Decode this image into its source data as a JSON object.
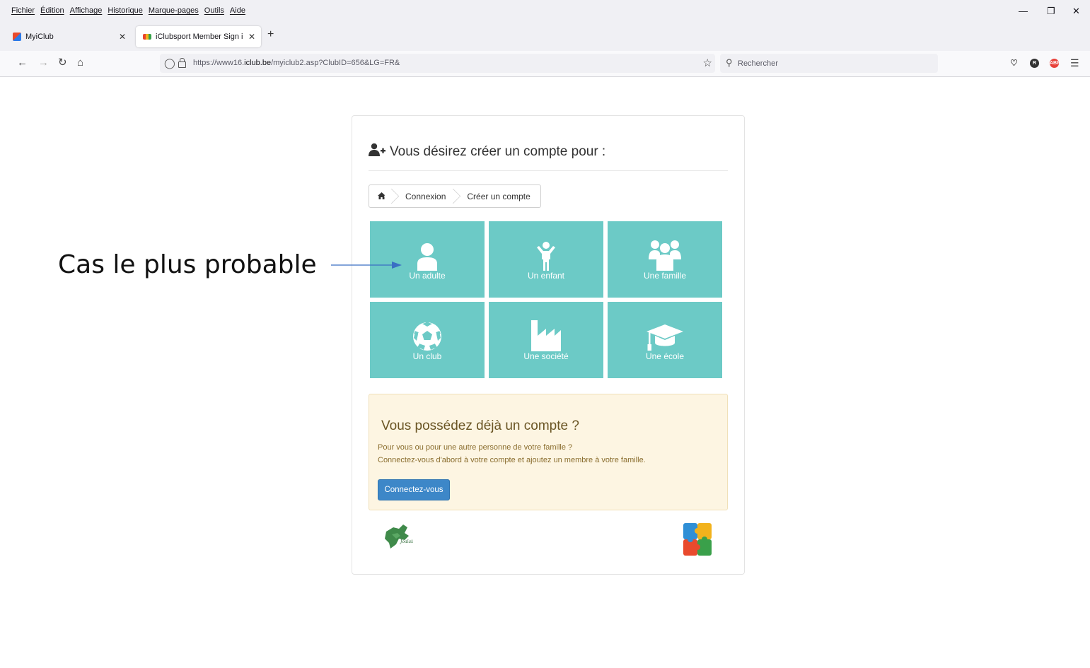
{
  "menubar": {
    "items": [
      "Fichier",
      "Édition",
      "Affichage",
      "Historique",
      "Marque-pages",
      "Outils",
      "Aide"
    ]
  },
  "tabs": [
    {
      "title": "MyiClub",
      "favicon": "myiclub-icon"
    },
    {
      "title": "iClubsport Member Sign in",
      "favicon": "iclubsport-icon",
      "active": true
    }
  ],
  "navbar": {
    "url_prefix": "https://www16.",
    "url_domain": "iclub.be",
    "url_path": "/myiclub2.asp?ClubID=656&LG=FR&",
    "search_placeholder": "Rechercher"
  },
  "card": {
    "title": "Vous désirez créer un compte pour :",
    "breadcrumb": [
      "Connexion",
      "Créer un compte"
    ],
    "tiles": [
      {
        "label": "Un adulte",
        "icon": "user-icon"
      },
      {
        "label": "Un enfant",
        "icon": "child-icon"
      },
      {
        "label": "Une famille",
        "icon": "users-icon"
      },
      {
        "label": "Un club",
        "icon": "soccer-ball-icon"
      },
      {
        "label": "Une société",
        "icon": "factory-icon"
      },
      {
        "label": "Une école",
        "icon": "graduation-cap-icon"
      }
    ],
    "existing": {
      "heading": "Vous possédez déjà un compte ?",
      "line1": "Pour vous ou pour une autre personne de votre famille ?",
      "line2": "Connectez-vous d'abord à votre compte et ajoutez un membre à votre famille.",
      "button": "Connectez-vous"
    }
  },
  "annotation": {
    "text": "Cas le plus probable"
  },
  "colors": {
    "tile": "#6ccac6",
    "button": "#3d87c8",
    "notice_bg": "#fdf5e2"
  }
}
